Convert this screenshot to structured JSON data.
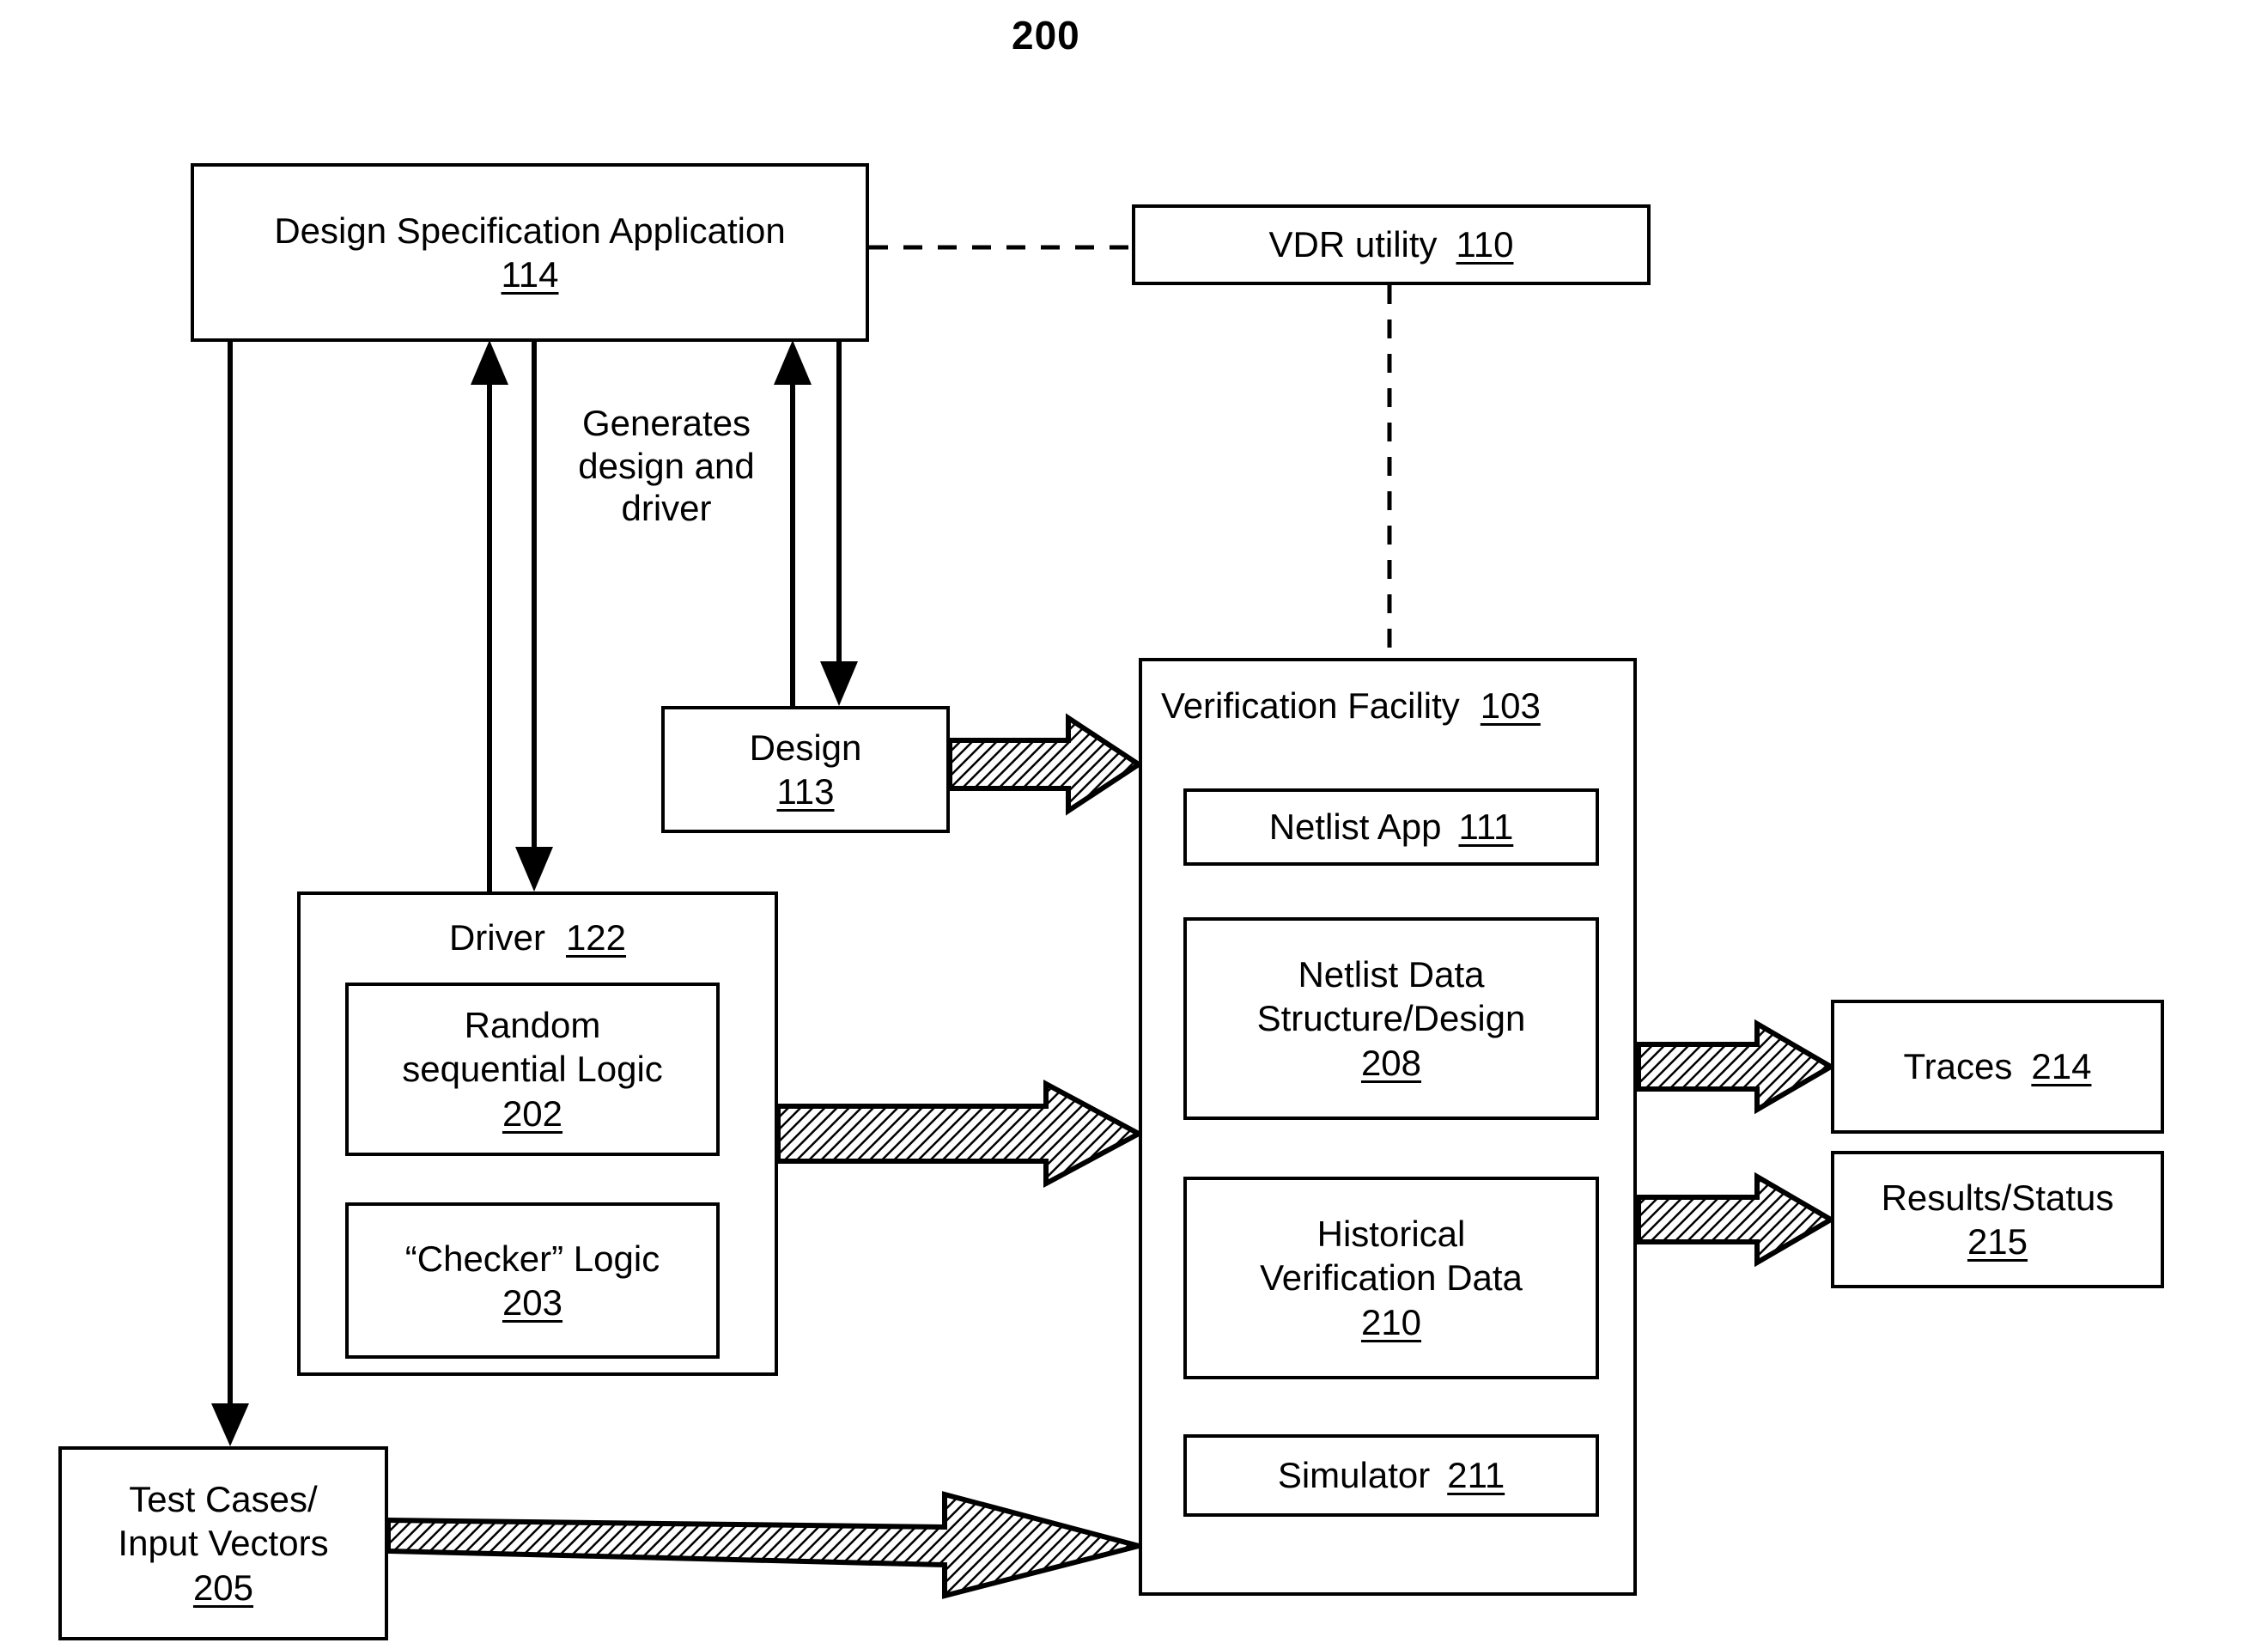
{
  "figure": {
    "number": "200"
  },
  "nodes": {
    "design_spec_app": {
      "label": "Design Specification Application",
      "ref": "114"
    },
    "vdr_utility": {
      "label": "VDR utility",
      "ref": "110"
    },
    "design": {
      "label": "Design",
      "ref": "113"
    },
    "driver": {
      "label": "Driver",
      "ref": "122"
    },
    "random_logic": {
      "label": "Random\nsequential Logic",
      "ref": "202"
    },
    "checker_logic": {
      "label": "“Checker” Logic",
      "ref": "203"
    },
    "test_cases": {
      "label": "Test Cases/\nInput Vectors",
      "ref": "205"
    },
    "verification_facility": {
      "label": "Verification Facility",
      "ref": "103"
    },
    "netlist_app": {
      "label": "Netlist App",
      "ref": "111"
    },
    "netlist_data": {
      "label": "Netlist Data\nStructure/Design",
      "ref": "208"
    },
    "historical_data": {
      "label": "Historical\nVerification Data",
      "ref": "210"
    },
    "simulator": {
      "label": "Simulator",
      "ref": "211"
    },
    "traces": {
      "label": "Traces",
      "ref": "214"
    },
    "results_status": {
      "label": "Results/Status",
      "ref": "215"
    }
  },
  "edges": {
    "generates": {
      "label": "Generates\ndesign and\ndriver"
    }
  },
  "colors": {
    "stroke": "#000000",
    "fill": "#ffffff",
    "hatch": "#000000"
  }
}
